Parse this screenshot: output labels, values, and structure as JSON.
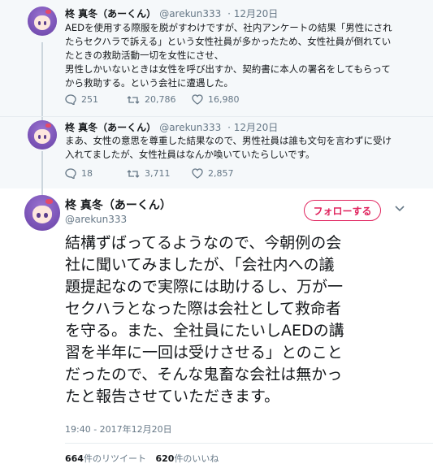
{
  "tweets": [
    {
      "name": "柊 真冬（あーくん）",
      "handle": "@arekun333",
      "date": "· 12月20日",
      "lines": [
        "AEDを使用する際服を脱がすわけですが、社内アンケートの結果「男性にされ",
        "たらセクハラで訴える」という女性社員が多かったため、女性社員が倒れてい",
        "たときの救助活動一切を女性にさせ、",
        "男性しかいないときは女性を呼び出すか、契約書に本人の署名をしてもらって",
        "から救助する。という会社に遭遇した。"
      ],
      "replies": "251",
      "retweets": "20,786",
      "likes": "16,980"
    },
    {
      "name": "柊 真冬（あーくん）",
      "handle": "@arekun333",
      "date": "· 12月20日",
      "lines": [
        "まあ、女性の意思を尊重した結果なので、男性社員は誰も文句を言わずに受け",
        "入れてましたが、女性社員はなんか喚いていたらしいです。"
      ],
      "replies": "18",
      "retweets": "3,711",
      "likes": "2,857"
    }
  ],
  "main": {
    "name": "柊 真冬（あーくん）",
    "handle": "@arekun333",
    "follow_label": "フォローする",
    "lines": [
      "結構ずばってるようなので、今朝例の会",
      "社に聞いてみましたが、「会社内への議",
      "題提起なので実際には助けるし、万が一",
      "セクハラとなった際は会社として救命者",
      "を守る。また、全社員にたいしAEDの講",
      "習を半年に一回は受けさせる」とのこと",
      "だったので、そんな鬼畜な会社は無かっ",
      "たと報告させていただきます。"
    ],
    "timestamp": "19:40 - 2017年12月20日",
    "retweet_count": "664",
    "retweet_label": "件のリツイート",
    "like_count": "620",
    "like_label": "件のいいね"
  },
  "colors": {
    "accent": "#e0245e",
    "muted": "#657786",
    "thread_bg": "#f5f8fa"
  }
}
